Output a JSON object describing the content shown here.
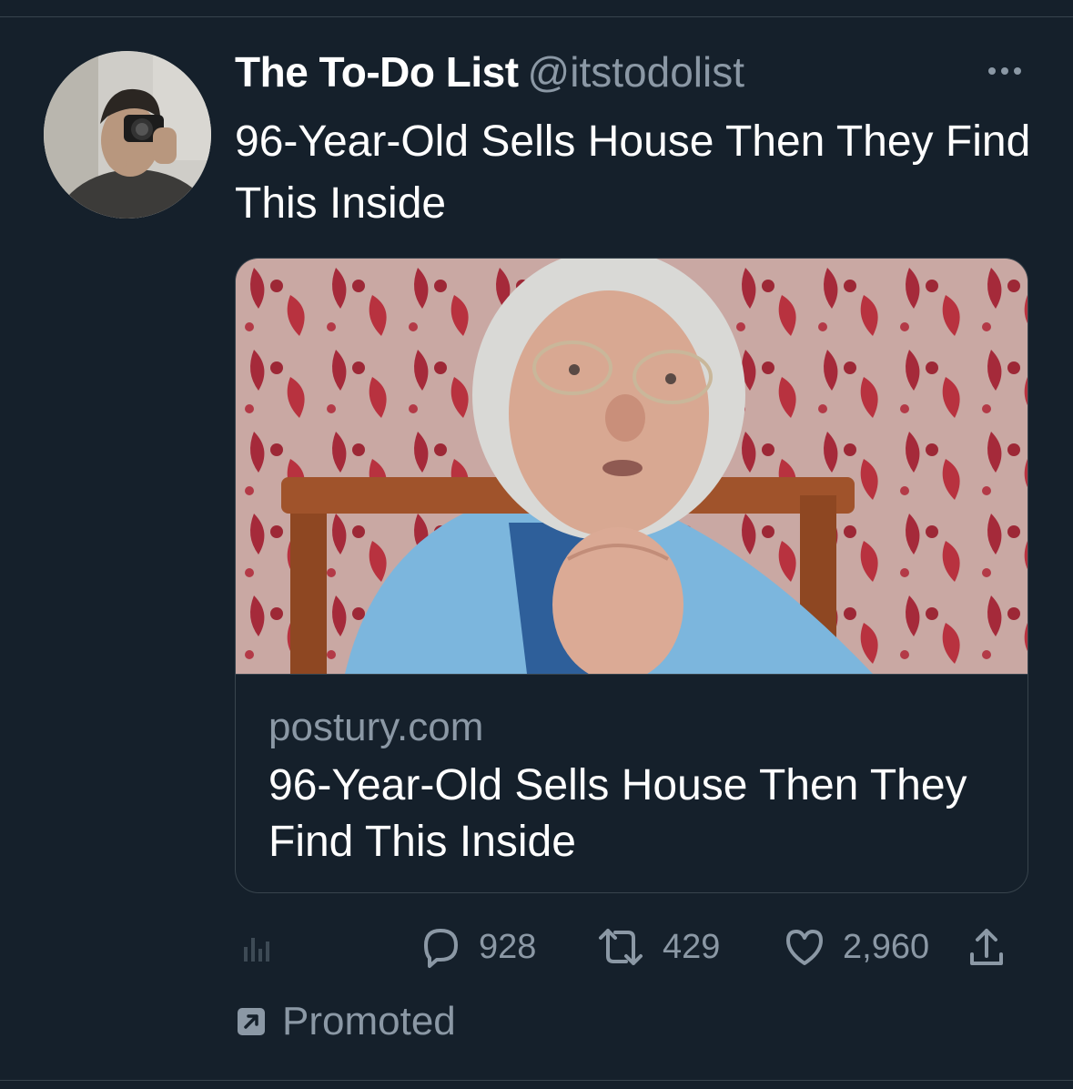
{
  "author": {
    "display_name": "The To-Do List",
    "handle": "@itstodolist"
  },
  "tweet": {
    "text": "96-Year-Old Sells House Then They Find This Inside"
  },
  "card": {
    "domain": "postury.com",
    "title": "96-Year-Old Sells House Then They Find This Inside"
  },
  "actions": {
    "replies": "928",
    "retweets": "429",
    "likes": "2,960"
  },
  "promoted_label": "Promoted",
  "icons": {
    "analytics": "bar-chart-icon",
    "reply": "speech-bubble-icon",
    "retweet": "retweet-arrows-icon",
    "like": "heart-icon",
    "share": "share-upload-icon",
    "promoted": "promoted-arrow-icon",
    "more": "three-dots-icon"
  },
  "colors": {
    "background": "#15202b",
    "secondary_text": "#8b98a5",
    "border": "#38444d"
  }
}
